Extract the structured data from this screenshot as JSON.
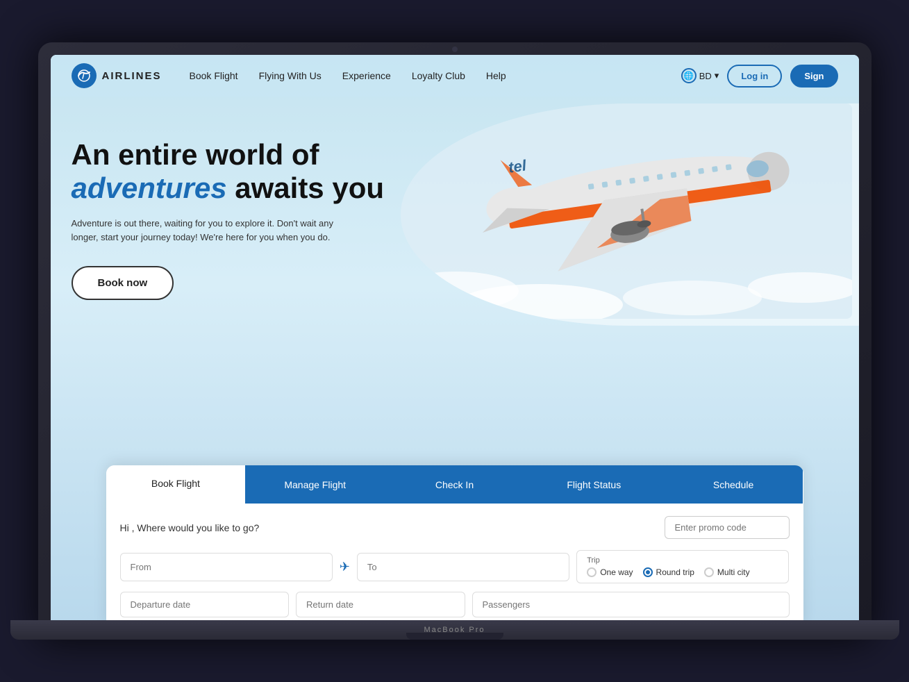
{
  "laptop": {
    "model_label": "MacBook Pro"
  },
  "navbar": {
    "logo_text": "AIRLINES",
    "links": [
      {
        "label": "Book Flight",
        "id": "book-flight"
      },
      {
        "label": "Flying With Us",
        "id": "flying-with-us"
      },
      {
        "label": "Experience",
        "id": "experience"
      },
      {
        "label": "Loyalty Club",
        "id": "loyalty-club"
      },
      {
        "label": "Help",
        "id": "help"
      }
    ],
    "language_code": "BD",
    "login_label": "Log in",
    "signup_label": "Sign"
  },
  "hero": {
    "title_line1": "An entire world of",
    "title_accent": "adventures",
    "title_line2_rest": " awaits you",
    "subtitle": "Adventure is out there, waiting for you to explore it. Don't wait any longer, start your journey today! We're here for you when you do.",
    "book_now_label": "Book now"
  },
  "booking": {
    "tabs": [
      {
        "label": "Book Flight",
        "active": true
      },
      {
        "label": "Manage Flight",
        "active": false
      },
      {
        "label": "Check In",
        "active": false
      },
      {
        "label": "Flight Status",
        "active": false
      },
      {
        "label": "Schedule",
        "active": false
      }
    ],
    "greeting": "Hi , Where would you like to go?",
    "promo_placeholder": "Enter promo code",
    "from_placeholder": "From",
    "to_placeholder": "To",
    "trip_label": "Trip",
    "trip_options": [
      {
        "label": "One way",
        "selected": false
      },
      {
        "label": "Round trip",
        "selected": true
      },
      {
        "label": "Multi city",
        "selected": false
      }
    ],
    "departure_placeholder": "Departure date",
    "return_placeholder": "Return date",
    "passengers_placeholder": "Passengers"
  },
  "colors": {
    "primary": "#1a6bb5",
    "accent": "#1a6bb5",
    "hero_bg": "#c5e4f0"
  }
}
